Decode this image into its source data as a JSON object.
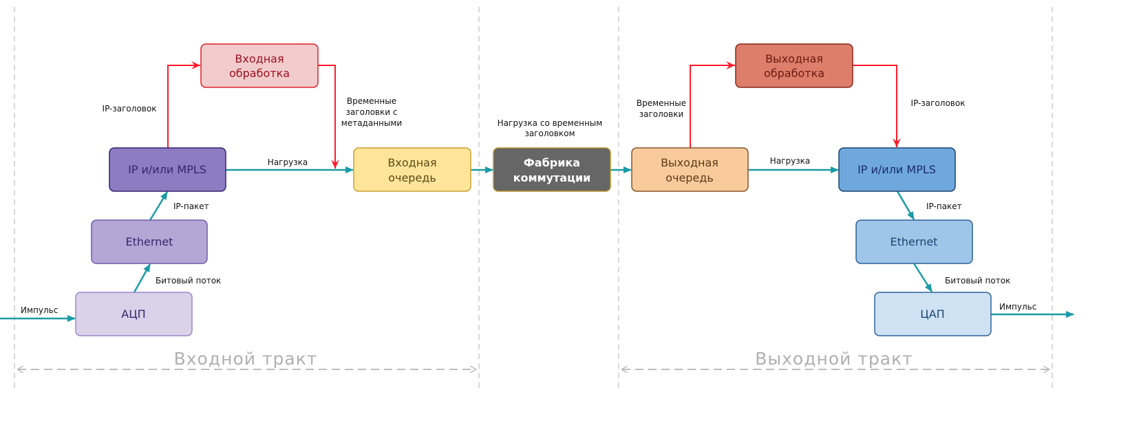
{
  "colors": {
    "flow_arrow": "#1a9ba6",
    "header_arrow": "#ff1a2a",
    "guide": "#bdbdbd"
  },
  "sections": {
    "ingress": "Входной тракт",
    "egress": "Выходной тракт"
  },
  "nodes": {
    "ingress_processing": [
      "Входная",
      "обработка"
    ],
    "ingress_ip_mpls": "IP и/или MPLS",
    "ingress_ethernet": "Ethernet",
    "adc": "АЦП",
    "ingress_queue": [
      "Входная",
      "очередь"
    ],
    "switch_fabric": [
      "Фабрика",
      "коммутации"
    ],
    "egress_queue": [
      "Выходная",
      "очередь"
    ],
    "egress_processing": [
      "Выходная",
      "обработка"
    ],
    "egress_ip_mpls": "IP и/или MPLS",
    "egress_ethernet": "Ethernet",
    "dac": "ЦАП"
  },
  "labels": {
    "ingress_ip_header": "IP-заголовок",
    "ingress_temp_headers": [
      "Временные",
      "заголовки с",
      "метаданными"
    ],
    "ingress_payload": "Нагрузка",
    "ingress_ip_packet": "IP-пакет",
    "ingress_bitstream": "Битовый поток",
    "ingress_pulse": "Импульс",
    "fabric_payload": [
      "Нагрузка со временным",
      "заголовком"
    ],
    "egress_temp_headers": [
      "Временные",
      "заголовки"
    ],
    "egress_ip_header": "IP-заголовок",
    "egress_payload": "Нагрузка",
    "egress_ip_packet": "IP-пакет",
    "egress_bitstream": "Битовый поток",
    "egress_pulse": "Импульс"
  }
}
